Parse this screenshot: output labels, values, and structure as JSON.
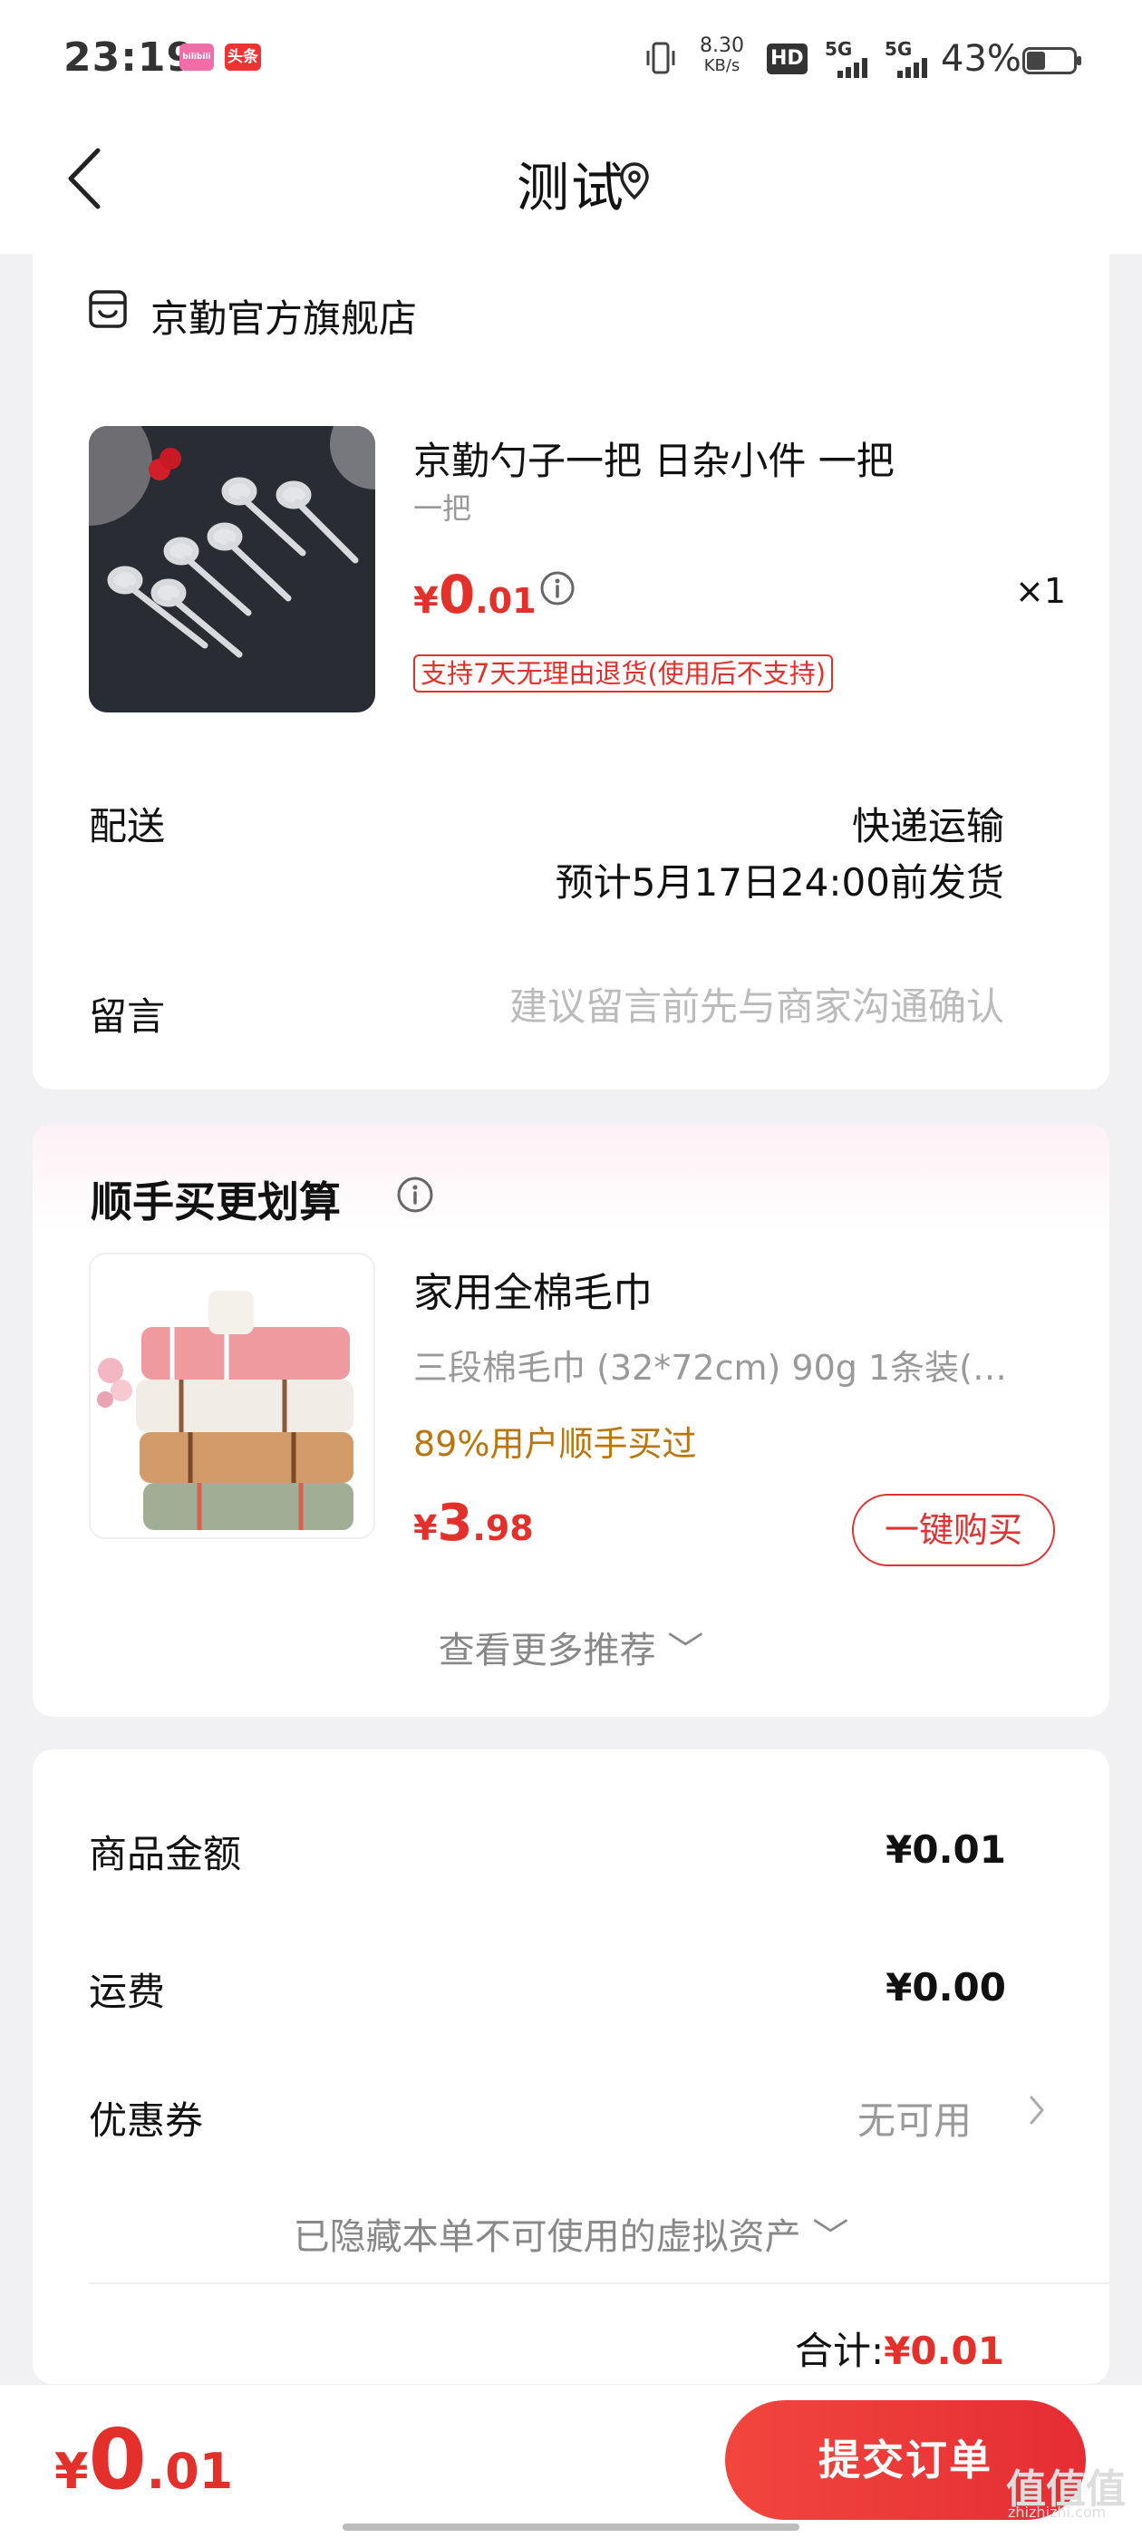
{
  "status_bar": {
    "time": "23:19",
    "badge_1": "bilibili",
    "badge_2": "头条",
    "net_speed_top": "8.30",
    "net_speed_bottom": "KB/s",
    "hd": "HD",
    "signal_1": "5G",
    "signal_2": "5G",
    "battery": "43%"
  },
  "nav": {
    "title": "测试",
    "back_icon": "chevron-left-icon",
    "location_icon": "location-pin-icon"
  },
  "store": {
    "icon": "store-icon",
    "name": "京勤官方旗舰店"
  },
  "product": {
    "title": "京勤勺子一把 日杂小件 一把",
    "spec": "一把",
    "price_symbol": "¥",
    "price_int": "0",
    "price_dec": ".01",
    "quantity": "×1",
    "return_policy": "支持7天无理由退货(使用后不支持)"
  },
  "delivery": {
    "label": "配送",
    "method": "快递运输",
    "estimate": "预计5月17日24:00前发货"
  },
  "message": {
    "label": "留言",
    "placeholder": "建议留言前先与商家沟通确认"
  },
  "recommendation": {
    "title": "顺手买更划算",
    "item": {
      "name": "家用全棉毛巾",
      "spec": "三段棉毛巾 (32*72cm)    90g 1条装(…",
      "social_proof": "89%用户顺手买过",
      "price_symbol": "¥",
      "price_int": "3",
      "price_dec": ".98",
      "buy_label": "一键购买"
    },
    "more_label": "查看更多推荐 ﹀"
  },
  "summary": {
    "goods_label": "商品金额",
    "goods_value": "¥0.01",
    "shipping_label": "运费",
    "shipping_value": "¥0.00",
    "coupon_label": "优惠券",
    "coupon_value": "无可用",
    "hidden_assets": "已隐藏本单不可使用的虚拟资产 ﹀",
    "total_label": "合计:",
    "total_value": "¥0.01"
  },
  "bottom_bar": {
    "price_symbol": "¥",
    "price_int": "0",
    "price_dec": ".01",
    "submit_label": "提交订单"
  },
  "watermark": {
    "logo": "值值值",
    "site": "zhizhizhi.com"
  },
  "colors": {
    "accent_red": "#e4302b",
    "social_orange": "#b8760c",
    "background": "#f1f1f3"
  }
}
